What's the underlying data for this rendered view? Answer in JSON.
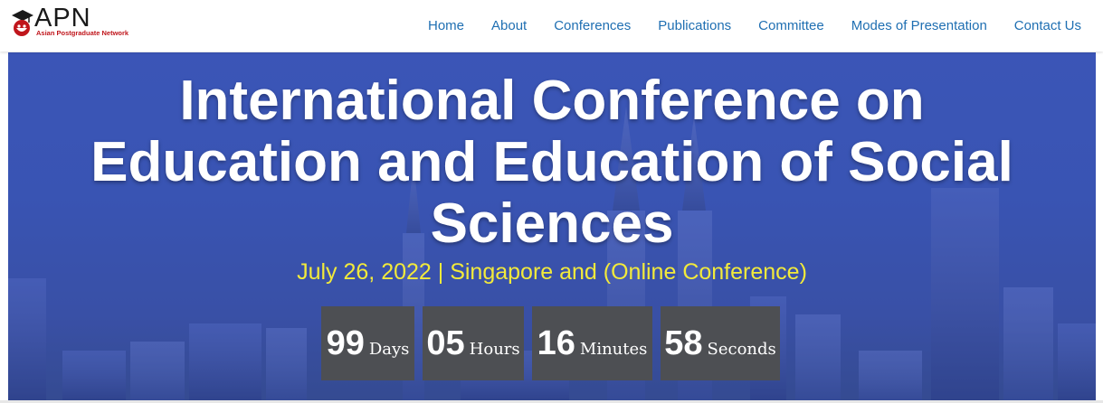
{
  "logo": {
    "brand": "APN",
    "tagline": "Asian Postgraduate Network"
  },
  "nav": [
    {
      "label": "Home"
    },
    {
      "label": "About"
    },
    {
      "label": "Conferences"
    },
    {
      "label": "Publications"
    },
    {
      "label": "Committee"
    },
    {
      "label": "Modes of Presentation"
    },
    {
      "label": "Contact Us"
    }
  ],
  "hero": {
    "title": "International Conference on Education and Education of Social Sciences",
    "subtitle": "July 26, 2022 | Singapore and (Online Conference)",
    "countdown": [
      {
        "value": "99",
        "unit": "Days"
      },
      {
        "value": "05",
        "unit": "Hours"
      },
      {
        "value": "16",
        "unit": "Minutes"
      },
      {
        "value": "58",
        "unit": "Seconds"
      }
    ]
  },
  "colors": {
    "nav_link": "#1f6fb2",
    "brand_red": "#c0161c",
    "hero_blue": "#3c57b8",
    "subtitle_yellow": "#f2ea3b",
    "countdown_box": "#4d4f53"
  }
}
